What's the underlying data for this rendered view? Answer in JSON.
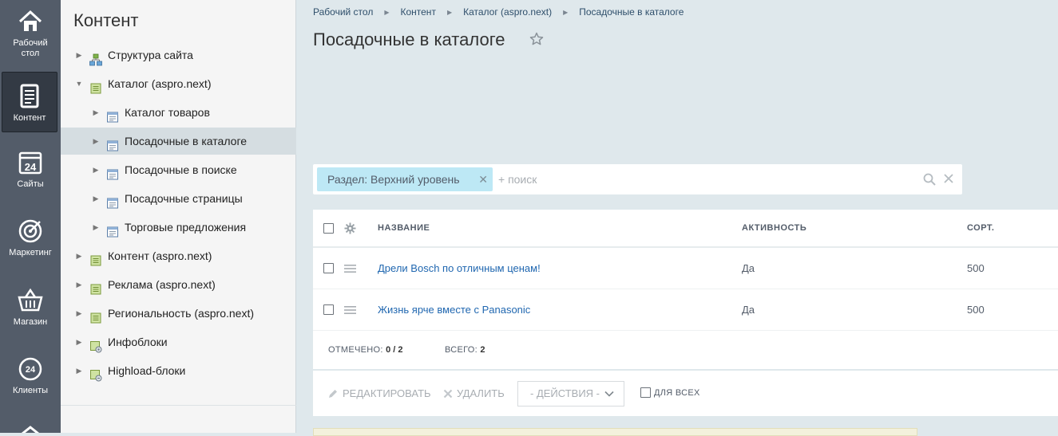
{
  "left_menu": {
    "items": [
      {
        "label": "Рабочий\nстол",
        "icon": "home-icon"
      },
      {
        "label": "Контент",
        "icon": "document-icon",
        "active": true
      },
      {
        "label": "Сайты",
        "icon": "calendar-24-icon"
      },
      {
        "label": "Маркетинг",
        "icon": "target-icon"
      },
      {
        "label": "Магазин",
        "icon": "basket-icon"
      },
      {
        "label": "Клиенты",
        "icon": "clients-24-icon"
      }
    ]
  },
  "tree": {
    "title": "Контент",
    "nodes": [
      {
        "label": "Структура сайта",
        "level": 0,
        "expanded": false,
        "icon": "site-structure-icon"
      },
      {
        "label": "Каталог (aspro.next)",
        "level": 0,
        "expanded": true,
        "icon": "iblock-type-icon"
      },
      {
        "label": "Каталог товаров",
        "level": 1,
        "expanded": false,
        "icon": "iblock-icon"
      },
      {
        "label": "Посадочные в каталоге",
        "level": 1,
        "expanded": false,
        "icon": "iblock-icon",
        "selected": true
      },
      {
        "label": "Посадочные в поиске",
        "level": 1,
        "expanded": false,
        "icon": "iblock-icon"
      },
      {
        "label": "Посадочные страницы",
        "level": 1,
        "expanded": false,
        "icon": "iblock-icon"
      },
      {
        "label": "Торговые предложения",
        "level": 1,
        "expanded": false,
        "icon": "iblock-icon"
      },
      {
        "label": "Контент (aspro.next)",
        "level": 0,
        "expanded": false,
        "icon": "iblock-type-icon"
      },
      {
        "label": "Реклама (aspro.next)",
        "level": 0,
        "expanded": false,
        "icon": "iblock-type-icon"
      },
      {
        "label": "Региональность (aspro.next)",
        "level": 0,
        "expanded": false,
        "icon": "iblock-type-icon"
      },
      {
        "label": "Инфоблоки",
        "level": 0,
        "expanded": false,
        "icon": "iblocks-settings-icon"
      },
      {
        "label": "Highload-блоки",
        "level": 0,
        "expanded": false,
        "icon": "highload-icon"
      }
    ]
  },
  "breadcrumb": [
    "Рабочий стол",
    "Контент",
    "Каталог (aspro.next)",
    "Посадочные в каталоге"
  ],
  "page_title": "Посадочные в каталоге",
  "filter": {
    "tag": "Раздел: Верхний уровень",
    "placeholder": "+ поиск"
  },
  "grid": {
    "columns": [
      "НАЗВАНИЕ",
      "АКТИВНОСТЬ",
      "СОРТ."
    ],
    "rows": [
      {
        "name": "Дрели Bosch по отличным ценам!",
        "active": "Да",
        "sort": "500"
      },
      {
        "name": "Жизнь ярче вместе с Panasonic",
        "active": "Да",
        "sort": "500"
      }
    ],
    "footer": {
      "selected_label": "ОТМЕЧЕНО:",
      "selected_value": "0 / 2",
      "total_label": "ВСЕГО:",
      "total_value": "2"
    }
  },
  "actions": {
    "edit_label": "РЕДАКТИРОВАТЬ",
    "delete_label": "УДАЛИТЬ",
    "select_label": "- ДЕЙСТВИЯ -",
    "for_all_label": "ДЛЯ ВСЕХ"
  },
  "colors": {
    "left_menu_bg": "#535c69",
    "tree_bg": "#f5f5f5",
    "page_bg": "#dfe8ec",
    "filter_tag_bg": "#bde8f5",
    "link": "#2067b0"
  }
}
